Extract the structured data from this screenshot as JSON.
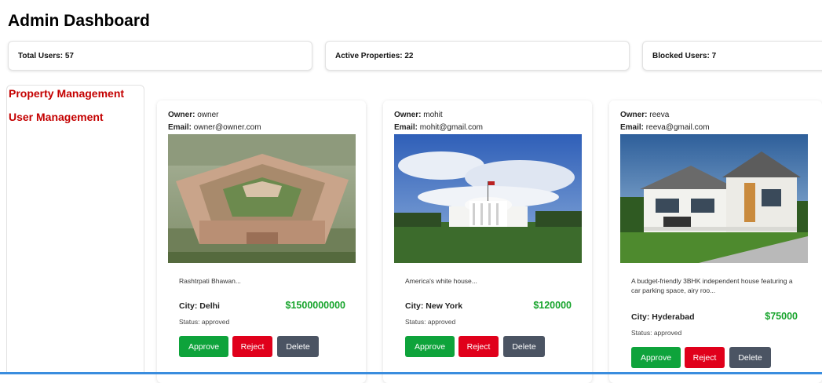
{
  "header": {
    "title": "Admin Dashboard"
  },
  "stats": [
    {
      "label": "Total Users: 57"
    },
    {
      "label": "Active Properties: 22"
    },
    {
      "label": "Blocked Users: 7"
    }
  ],
  "sidebar": {
    "items": [
      {
        "label": "Property Management"
      },
      {
        "label": "User Management"
      }
    ]
  },
  "common": {
    "owner_label": "Owner:",
    "email_label": "Email:",
    "city_label": "City:",
    "approve_label": "Approve",
    "reject_label": "Reject",
    "delete_label": "Delete"
  },
  "properties": [
    {
      "owner": "owner",
      "email": "owner@owner.com",
      "description": "Rashtrpati Bhawan...",
      "city": "Delhi",
      "price": "$1500000000",
      "status": "Status: approved"
    },
    {
      "owner": "mohit",
      "email": "mohit@gmail.com",
      "description": "America's white house...",
      "city": "New York",
      "price": "$120000",
      "status": "Status: approved"
    },
    {
      "owner": "reeva",
      "email": "reeva@gmail.com",
      "description": "A budget-friendly 3BHK independent house featuring a car parking space, airy roo...",
      "city": "Hyderabad",
      "price": "$75000",
      "status": "Status: approved"
    }
  ],
  "colors": {
    "accent_red": "#c40000",
    "price_green": "#15a32a",
    "approve": "#0ea33b",
    "reject": "#e0001b",
    "delete": "#4b5463"
  }
}
